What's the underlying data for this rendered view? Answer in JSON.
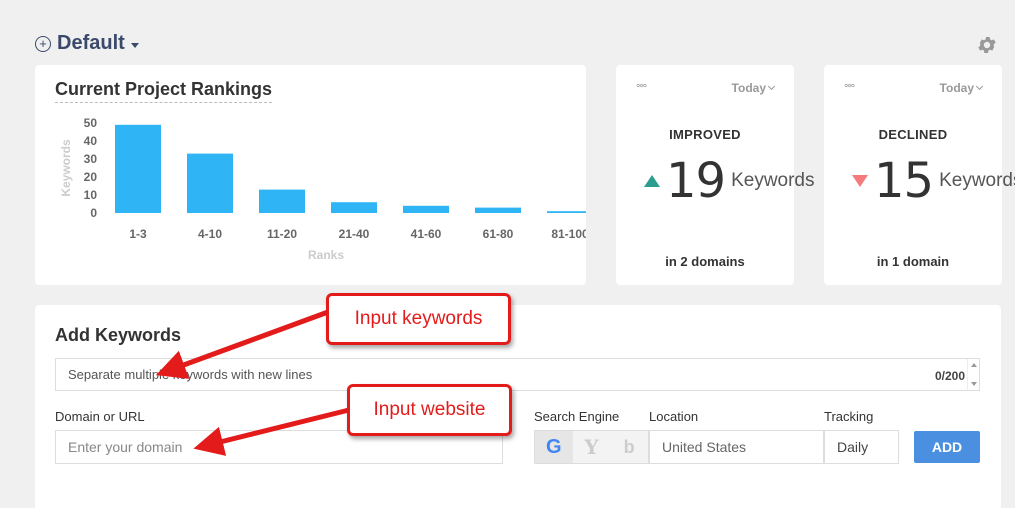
{
  "project": {
    "name": "Default"
  },
  "rankings": {
    "title": "Current Project Rankings"
  },
  "chart_data": {
    "type": "bar",
    "categories": [
      "1-3",
      "4-10",
      "11-20",
      "21-40",
      "41-60",
      "61-80",
      "81-100"
    ],
    "values": [
      49,
      33,
      13,
      6,
      4,
      3,
      1
    ],
    "xlabel": "Ranks",
    "ylabel": "Keywords",
    "ylim": [
      0,
      50
    ],
    "yticks": [
      0,
      10,
      20,
      30,
      40,
      50
    ],
    "grid": false,
    "color": "#2fb5f5"
  },
  "improved": {
    "period": "Today",
    "label": "IMPROVED",
    "count": "19",
    "unit": "Keywords",
    "domains": "in 2 domains",
    "color": "#2a9d8f"
  },
  "declined": {
    "period": "Today",
    "label": "DECLINED",
    "count": "15",
    "unit": "Keywords",
    "domains": "in 1 domain",
    "color": "#f47b7b"
  },
  "add_keywords": {
    "title": "Add Keywords",
    "keywords_placeholder": "Separate multiple keywords with new lines",
    "counter": "0/200",
    "domain_label": "Domain or URL",
    "domain_placeholder": "Enter your domain",
    "engine_label": "Search Engine",
    "engines": [
      "G",
      "Y",
      "b"
    ],
    "location_label": "Location",
    "location_value": "United States",
    "tracking_label": "Tracking",
    "tracking_value": "Daily",
    "add_button": "ADD"
  },
  "annotations": {
    "keywords_callout": "Input keywords",
    "website_callout": "Input website"
  }
}
